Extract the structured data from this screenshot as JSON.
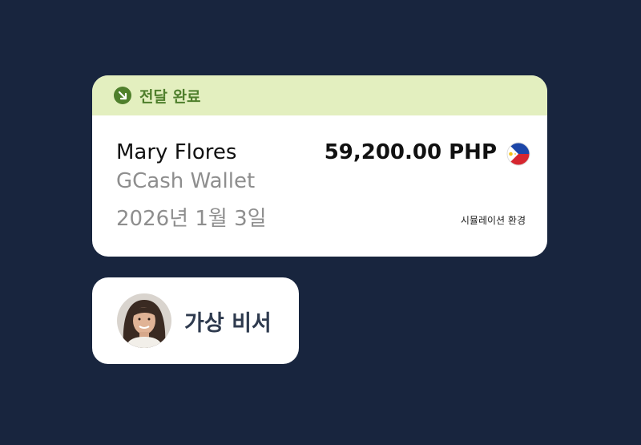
{
  "transfer": {
    "status": "전달 완료",
    "recipient_name": "Mary Flores",
    "method": "GCash Wallet",
    "date": "2026년 1월 3일",
    "amount": "59,200.00 PHP",
    "currency_flag_icon": "philippines-flag-icon",
    "environment_note": "시뮬레이션 환경"
  },
  "assistant": {
    "label": "가상 비서",
    "avatar_icon": "assistant-avatar"
  },
  "colors": {
    "background": "#18253e",
    "status_header": "#e3efbf",
    "status_accent": "#4f7f2c",
    "secondary_text": "#8e8e8e"
  }
}
